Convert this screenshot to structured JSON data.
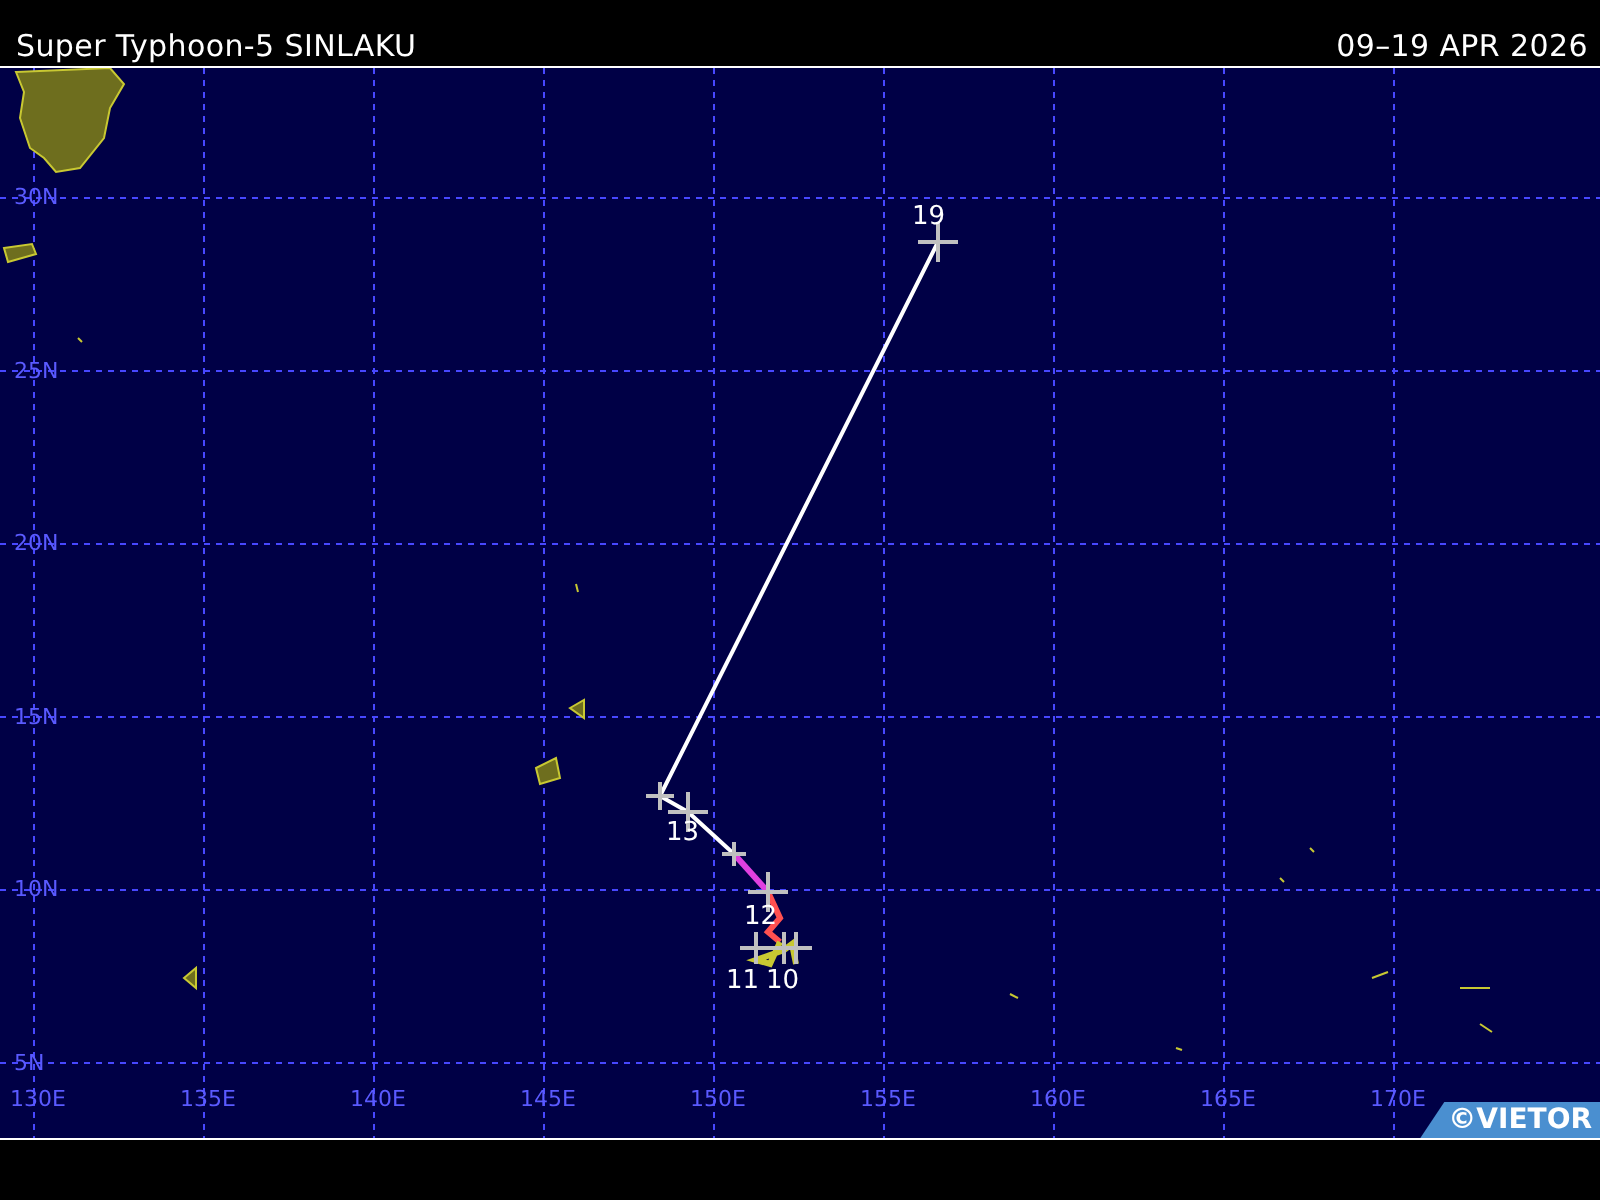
{
  "header": {
    "title": "Super Typhoon-5 SINLAKU",
    "date_range": "09–19 APR 2026"
  },
  "map": {
    "lat_labels": [
      "30N",
      "25N",
      "20N",
      "15N",
      "10N",
      "5N"
    ],
    "lon_labels": [
      "130E",
      "135E",
      "140E",
      "145E",
      "150E",
      "155E",
      "160E",
      "165E",
      "170E"
    ],
    "track_labels": [
      "19",
      "13",
      "12",
      "11",
      "10"
    ],
    "credit": "©VIETOR"
  }
}
